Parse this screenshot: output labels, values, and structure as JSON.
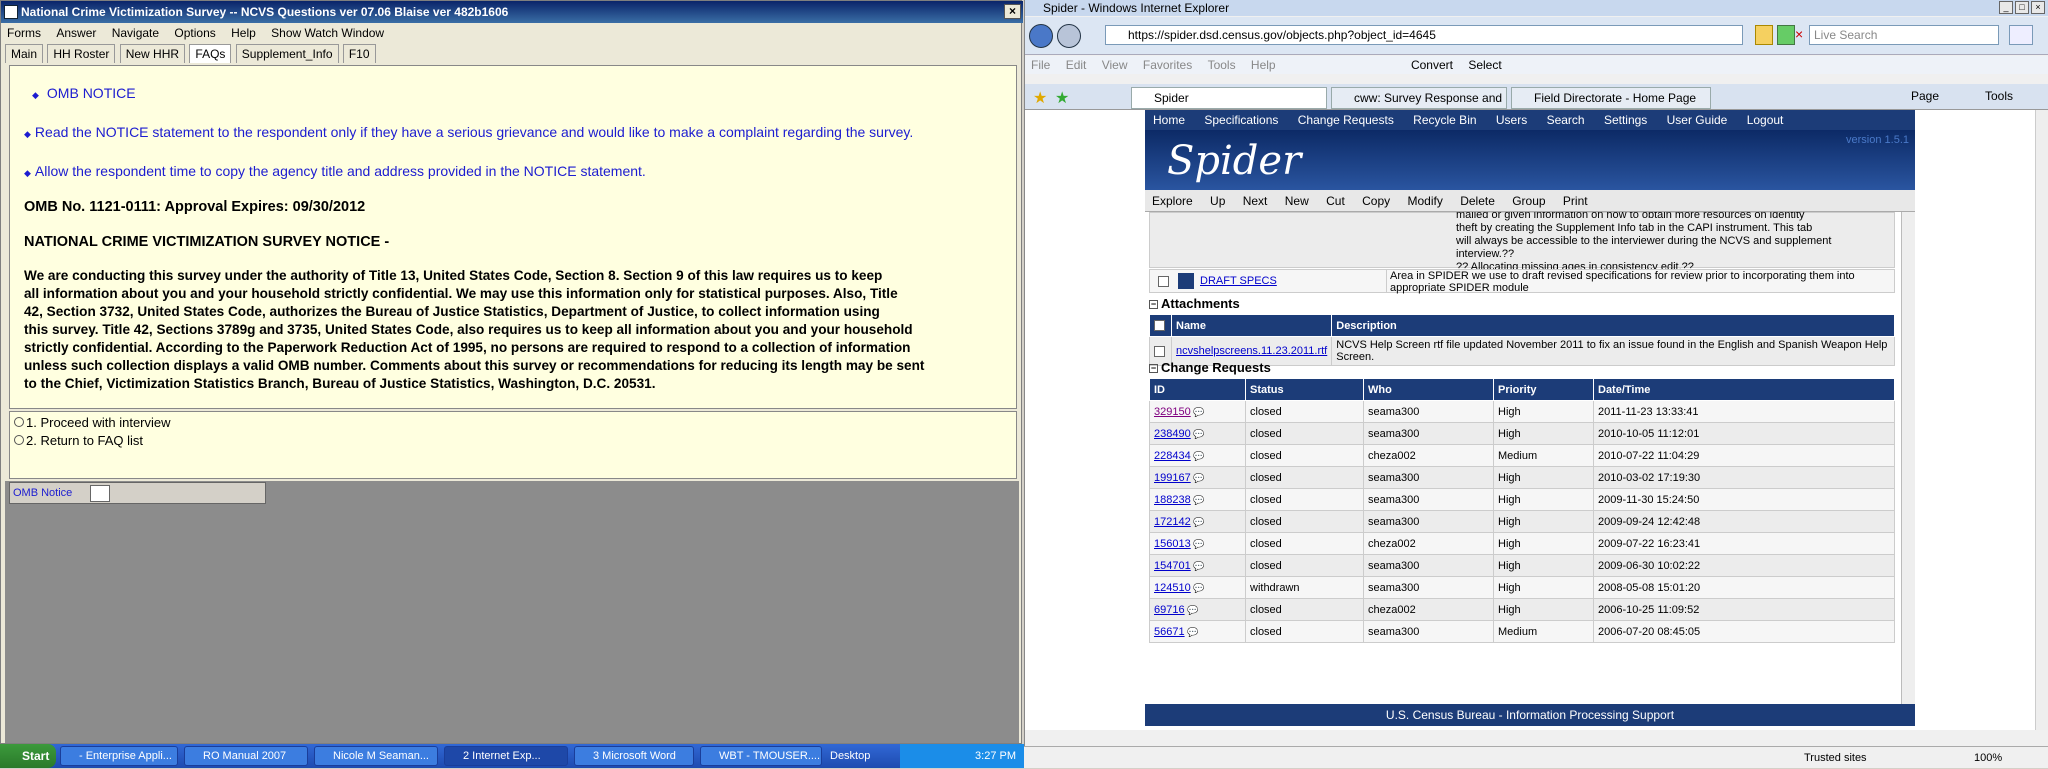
{
  "left_window": {
    "title": "National Crime Victimization Survey -- NCVS Questions ver 07.06 Blaise ver 482b1606",
    "close": "×",
    "menu": [
      "Forms",
      "Answer",
      "Navigate",
      "Options",
      "Help",
      "Show Watch Window"
    ],
    "tabs": [
      "Main",
      "HH Roster",
      "New HHR",
      "FAQs",
      "Supplement_Info",
      "F10"
    ],
    "active_tab": "FAQs",
    "bullets": [
      "OMB NOTICE",
      "Read the NOTICE statement to the respondent only if they have a serious grievance and would like to make a complaint regarding the survey.",
      "Allow the respondent time to copy the agency title and address provided in the NOTICE statement."
    ],
    "bullet_symbol": "◆",
    "omb_no": "OMB No. 1121-0111: Approval Expires: 09/30/2012",
    "notice_heading": "NATIONAL CRIME VICTIMIZATION SURVEY NOTICE -",
    "notice_lines": [
      "We are conducting this survey under the authority of Title 13, United States Code, Section 8. Section 9 of this law requires us to keep",
      "all information about you and your household strictly confidential. We may use this information only for statistical purposes.  Also, Title",
      "42, Section 3732, United States Code, authorizes the Bureau of Justice Statistics, Department of Justice, to collect information using",
      "this survey. Title 42, Sections 3789g and 3735, United States Code, also requires us to keep all information about you and your household",
      "strictly confidential.  According to the Paperwork Reduction Act of 1995, no  persons are required to respond to a collection of information",
      "unless such collection displays a valid OMB number.  Comments about this survey or recommendations for reducing its length may be sent",
      "to the Chief, Victimization Statistics Branch, Bureau of Justice Statistics,  Washington, D.C. 20531."
    ],
    "answers": [
      "1.  Proceed with interview",
      "2.  Return to FAQ list"
    ],
    "field_label": "OMB Notice"
  },
  "right_window": {
    "title": "Spider - Windows Internet Explorer",
    "url": "https://spider.dsd.census.gov/objects.php?object_id=4645",
    "search_placeholder": "Live Search",
    "menu": [
      "File",
      "Edit",
      "View",
      "Favorites",
      "Tools",
      "Help"
    ],
    "convert": "Convert",
    "select": "Select",
    "tabs": [
      "Spider",
      "cww: Survey Response and ...",
      "Field Directorate - Home Page"
    ],
    "page_tools": [
      "Page",
      "Tools"
    ],
    "spider_nav": [
      "Home",
      "Specifications",
      "Change Requests",
      "Recycle Bin",
      "Users",
      "Search",
      "Settings",
      "User Guide",
      "Logout"
    ],
    "logo": "Spider",
    "version": "version 1.5.1",
    "spider_tools": [
      "Explore",
      "Up",
      "Next",
      "New",
      "Cut",
      "Copy",
      "Modify",
      "Delete",
      "Group",
      "Print"
    ],
    "top_note": [
      "mailed or given information on how to obtain more resources on identity",
      "theft by creating the Supplement Info tab in the CAPI instrument.  This tab",
      "will always be accessible to the interviewer during the NCVS and supplement",
      "interview.??",
      "",
      "?? Allocating missing ages in consistency edit.??"
    ],
    "draft_link": "DRAFT SPECS",
    "draft_desc": "Area in SPIDER we use to draft revised specifications for review prior to incorporating them into appropriate SPIDER module",
    "attachments_title": "Attachments",
    "attach_headers": [
      "Name",
      "Description"
    ],
    "attach_row": {
      "name": "ncvshelpscreens.11.23.2011.rtf",
      "desc": "NCVS Help Screen rtf file updated November 2011 to fix an issue found in the English and Spanish Weapon Help Screen."
    },
    "cr_title": "Change Requests",
    "cr_headers": [
      "ID",
      "Status",
      "Who",
      "Priority",
      "Date/Time"
    ],
    "cr_rows": [
      {
        "id": "329150",
        "status": "closed",
        "who": "seama300",
        "priority": "High",
        "dt": "2011-11-23 13:33:41"
      },
      {
        "id": "238490",
        "status": "closed",
        "who": "seama300",
        "priority": "High",
        "dt": "2010-10-05 11:12:01"
      },
      {
        "id": "228434",
        "status": "closed",
        "who": "cheza002",
        "priority": "Medium",
        "dt": "2010-07-22 11:04:29"
      },
      {
        "id": "199167",
        "status": "closed",
        "who": "seama300",
        "priority": "High",
        "dt": "2010-03-02 17:19:30"
      },
      {
        "id": "188238",
        "status": "closed",
        "who": "seama300",
        "priority": "High",
        "dt": "2009-11-30 15:24:50"
      },
      {
        "id": "172142",
        "status": "closed",
        "who": "seama300",
        "priority": "High",
        "dt": "2009-09-24 12:42:48"
      },
      {
        "id": "156013",
        "status": "closed",
        "who": "cheza002",
        "priority": "High",
        "dt": "2009-07-22 16:23:41"
      },
      {
        "id": "154701",
        "status": "closed",
        "who": "seama300",
        "priority": "High",
        "dt": "2009-06-30 10:02:22"
      },
      {
        "id": "124510",
        "status": "withdrawn",
        "who": "seama300",
        "priority": "High",
        "dt": "2008-05-08 15:01:20"
      },
      {
        "id": "69716",
        "status": "closed",
        "who": "cheza002",
        "priority": "High",
        "dt": "2006-10-25 11:09:52"
      },
      {
        "id": "56671",
        "status": "closed",
        "who": "seama300",
        "priority": "Medium",
        "dt": "2006-07-20 08:45:05"
      }
    ],
    "footer": "U.S. Census Bureau - Information Processing Support",
    "status_zone": "Trusted sites",
    "zoom": "100%"
  },
  "taskbar": {
    "start": "Start",
    "buttons": [
      "- Enterprise Appli...",
      "RO Manual 2007",
      "Nicole M Seaman...",
      "2 Internet Exp...",
      "3 Microsoft Word",
      "WBT - TMOUSER...."
    ],
    "desktop": "Desktop",
    "time": "3:27 PM"
  },
  "colors": {
    "survey_bg": "#ffffe0",
    "blue_text": "#1c1cd0",
    "spider_navy": "#1c3c78"
  }
}
